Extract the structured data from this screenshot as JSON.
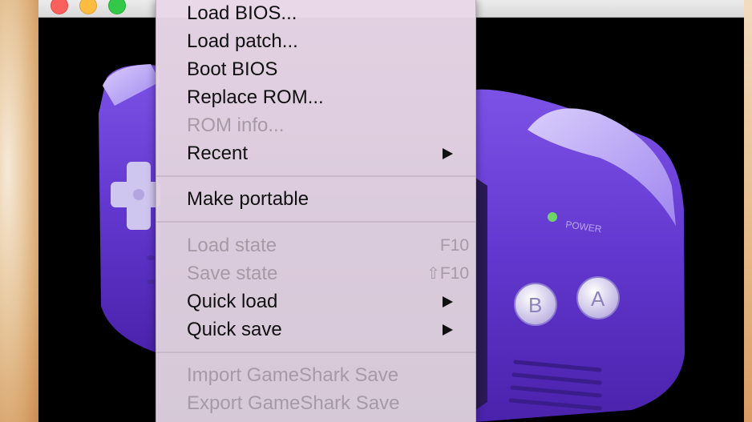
{
  "window": {
    "controls": {
      "close": "close-button",
      "minimize": "minimize-button",
      "maximize": "maximize-button"
    }
  },
  "console": {
    "power_label": "POWER",
    "button_b": "B",
    "button_a": "A"
  },
  "menu": {
    "items": [
      {
        "label": "Load BIOS...",
        "enabled": true
      },
      {
        "label": "Load patch...",
        "enabled": true
      },
      {
        "label": "Boot BIOS",
        "enabled": true
      },
      {
        "label": "Replace ROM...",
        "enabled": true
      },
      {
        "label": "ROM info...",
        "enabled": false
      },
      {
        "label": "Recent",
        "enabled": true,
        "submenu": true
      },
      {
        "label": "Make portable",
        "enabled": true
      },
      {
        "label": "Load state",
        "enabled": false,
        "shortcut": "F10"
      },
      {
        "label": "Save state",
        "enabled": false,
        "shortcut_modifier": "⇧",
        "shortcut": "F10"
      },
      {
        "label": "Quick load",
        "enabled": true,
        "submenu": true
      },
      {
        "label": "Quick save",
        "enabled": true,
        "submenu": true
      },
      {
        "label": "Import GameShark Save",
        "enabled": false
      },
      {
        "label": "Export GameShark Save",
        "enabled": false
      }
    ]
  },
  "colors": {
    "menu_text": "#111111",
    "menu_disabled_text": "#a79aa6",
    "console_purple": "#6a3fd0",
    "power_led": "#6fd36a"
  }
}
